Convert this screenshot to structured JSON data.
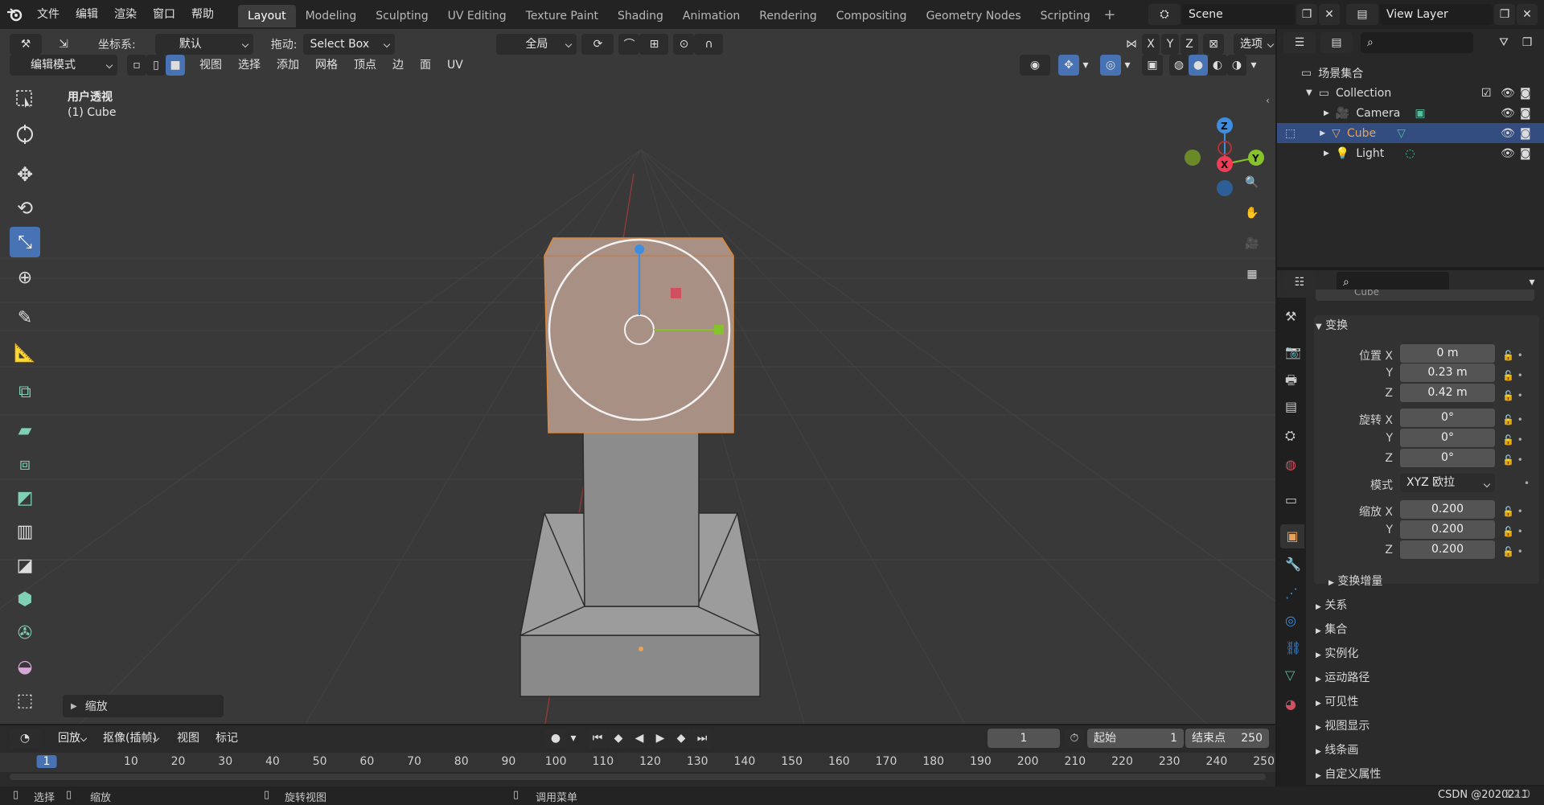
{
  "menu": {
    "items": [
      "文件",
      "编辑",
      "渲染",
      "窗口",
      "帮助"
    ]
  },
  "workspaces": [
    "Layout",
    "Modeling",
    "Sculpting",
    "UV Editing",
    "Texture Paint",
    "Shading",
    "Animation",
    "Rendering",
    "Compositing",
    "Geometry Nodes",
    "Scripting"
  ],
  "active_workspace": "Layout",
  "scene": {
    "name": "Scene",
    "view_layer": "View Layer"
  },
  "toolbar": {
    "coord_label": "坐标系:",
    "coord_value": "默认",
    "drag_label": "拖动:",
    "drag_value": "Select Box",
    "pivot_value": "全局",
    "axis_x": "X",
    "axis_y": "Y",
    "axis_z": "Z",
    "options_label": "选项"
  },
  "viewport_header": {
    "mode": "编辑模式",
    "menus": [
      "视图",
      "选择",
      "添加",
      "网格",
      "顶点",
      "边",
      "面",
      "UV"
    ]
  },
  "viewport": {
    "view_name": "用户透视",
    "object_label": "(1) Cube",
    "last_op_panel": "缩放",
    "gizmo_x": "X",
    "gizmo_y": "Y",
    "gizmo_z": "Z"
  },
  "outliner": {
    "root": "场景集合",
    "collection": "Collection",
    "items": [
      {
        "name": "Camera",
        "selected": false
      },
      {
        "name": "Cube",
        "selected": true
      },
      {
        "name": "Light",
        "selected": false
      }
    ]
  },
  "properties": {
    "object_name": "Cube",
    "transform_title": "变换",
    "location_label": "位置 X",
    "loc": [
      "0 m",
      "0.23 m",
      "0.42 m"
    ],
    "rotation_label": "旋转 X",
    "rot": [
      "0°",
      "0°",
      "0°"
    ],
    "mode_label": "模式",
    "mode_value": "XYZ 欧拉",
    "scale_label": "缩放 X",
    "scale": [
      "0.200",
      "0.200",
      "0.200"
    ],
    "y_label": "Y",
    "z_label": "Z",
    "delta_title": "变换增量",
    "sections": [
      "关系",
      "集合",
      "实例化",
      "运动路径",
      "可见性",
      "视图显示",
      "线条画",
      "自定义属性"
    ]
  },
  "timeline": {
    "playback": "回放",
    "keying": "抠像(插帧)",
    "view": "视图",
    "marker": "标记",
    "current_frame": "1",
    "start_label": "起始",
    "start_value": "1",
    "end_label": "结束点",
    "end_value": "250",
    "ruler": [
      "1",
      "10",
      "20",
      "30",
      "40",
      "50",
      "60",
      "70",
      "80",
      "90",
      "100",
      "110",
      "120",
      "130",
      "140",
      "150",
      "160",
      "170",
      "180",
      "190",
      "200",
      "210",
      "220",
      "230",
      "240",
      "250"
    ]
  },
  "statusbar": {
    "select": "选择",
    "scale": "缩放",
    "rotate_view": "旋转视图",
    "call_menu": "调用菜单",
    "watermark": "CSDN @2020211",
    "version": "3.2.0"
  },
  "colors": {
    "accent": "#4772b3",
    "selected_object": "#e8a35a",
    "x_axis": "#f23c55",
    "y_axis": "#86c22a",
    "z_axis": "#3e8de0"
  }
}
